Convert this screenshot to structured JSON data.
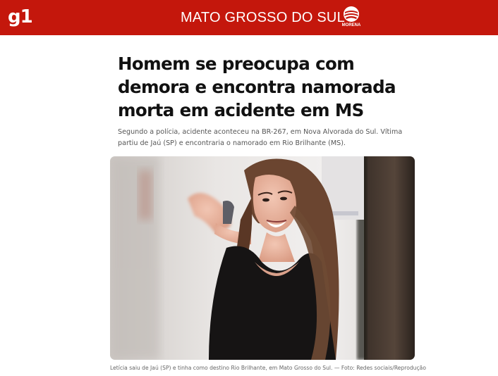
{
  "header": {
    "logo_text": "g1",
    "region": "MATO GROSSO DO SUL",
    "affiliate_label": "MORENA",
    "background_color": "#c4170c"
  },
  "article": {
    "headline": "Homem se preocupa com demora e encontra namorada morta em acidente em MS",
    "subtitle": "Segundo a polícia, acidente aconteceu na BR-267, em Nova Alvorada do Sul. Vítima partiu de Jaú (SP) e encontraria o namorado em Rio Brilhante (MS).",
    "image": {
      "description_icon": "photo-of-woman",
      "caption": "Letícia saiu de Jaú (SP) e tinha como destino Rio Brilhante, em Mato Grosso do Sul. — Foto: Redes sociais/Reprodução"
    }
  }
}
